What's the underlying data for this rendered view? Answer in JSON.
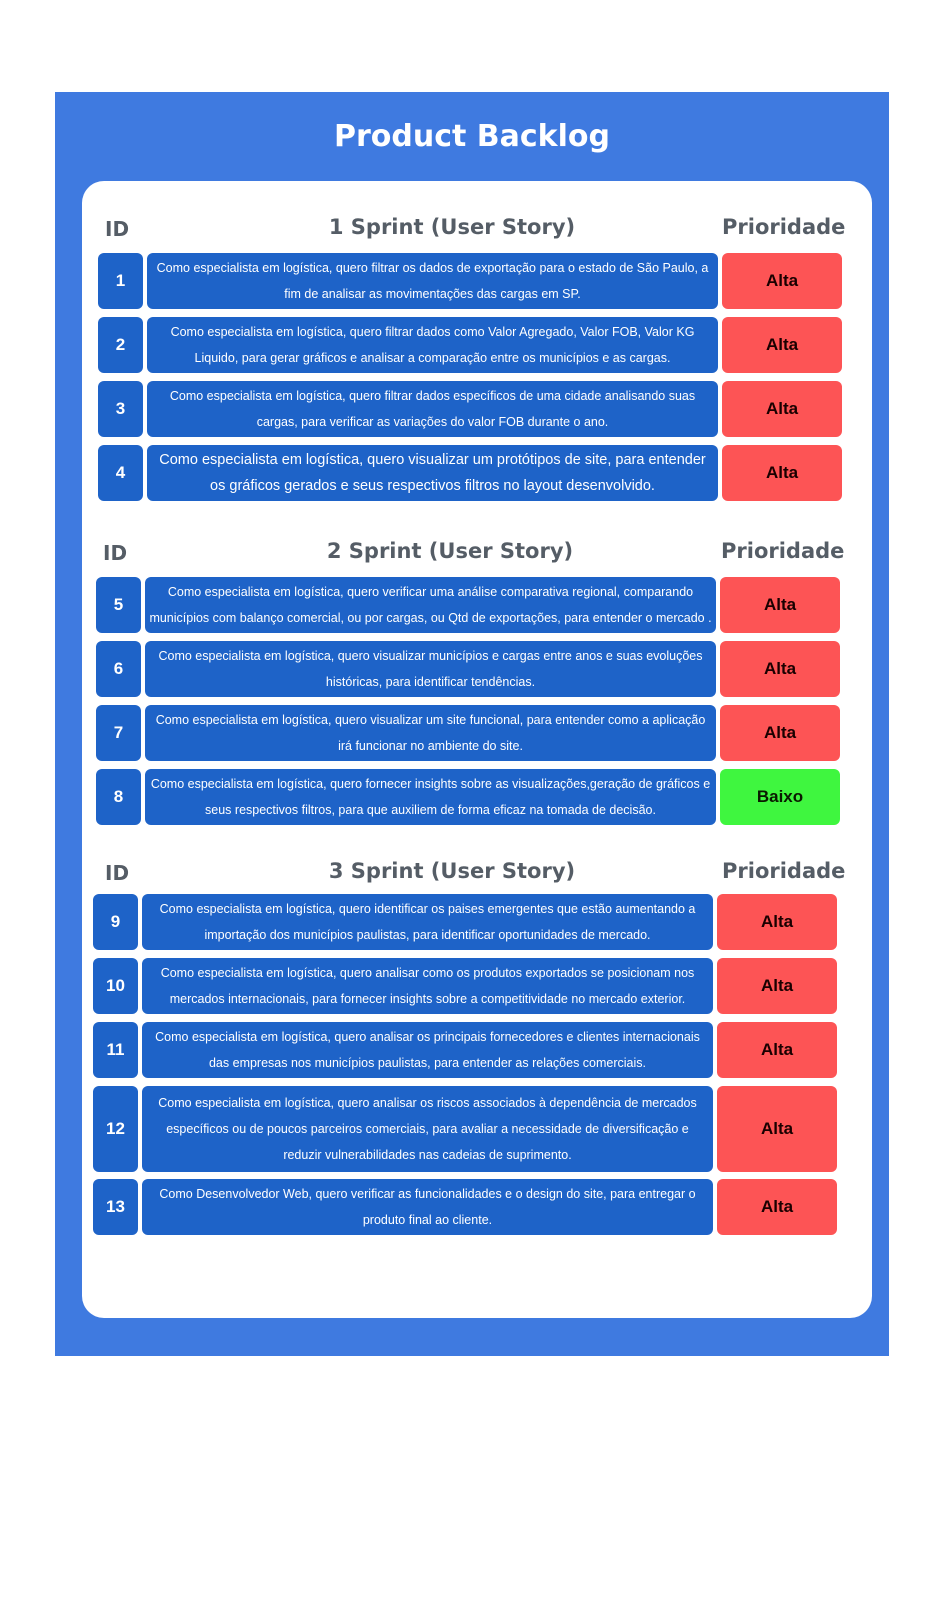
{
  "title": "Product Backlog",
  "colors": {
    "frame": "#3f7ae0",
    "cell_blue": "#1e63c8",
    "priority_high": "#fd5455",
    "priority_low": "#3ff63f",
    "header_text": "#555d66"
  },
  "sprints": [
    {
      "id_header": "ID",
      "title": "1 Sprint  (User Story)",
      "priority_header": "Prioridade",
      "rows": [
        {
          "id": "1",
          "story": "Como especialista em logística, quero filtrar os dados de exportação para o estado de São Paulo, a fim de analisar as movimentações das cargas em SP.",
          "priority": "Alta"
        },
        {
          "id": "2",
          "story": "Como especialista em logística, quero filtrar dados como Valor Agregado, Valor FOB, Valor KG Liquido, para gerar gráficos e analisar a comparação entre os municípios e as cargas.",
          "priority": "Alta"
        },
        {
          "id": "3",
          "story": "Como especialista em logística, quero filtrar dados específicos de uma cidade analisando suas cargas, para verificar as variações do valor FOB durante o ano.",
          "priority": "Alta"
        },
        {
          "id": "4",
          "story": "Como especialista em logística, quero visualizar um protótipos de site, para entender os gráficos gerados e seus respectivos filtros no layout desenvolvido.",
          "priority": "Alta"
        }
      ]
    },
    {
      "id_header": "ID",
      "title": "2 Sprint  (User Story)",
      "priority_header": "Prioridade",
      "rows": [
        {
          "id": "5",
          "story": "Como especialista em logística, quero verificar uma análise comparativa regional, comparando municípios com balanço comercial, ou por cargas, ou Qtd de exportações, para entender o mercado .",
          "priority": "Alta"
        },
        {
          "id": "6",
          "story": "Como especialista em logística, quero visualizar municípios e cargas entre anos e suas evoluções históricas, para identificar tendências.",
          "priority": "Alta"
        },
        {
          "id": "7",
          "story": "Como especialista em logística, quero visualizar um site funcional, para entender como a aplicação irá funcionar no ambiente do site.",
          "priority": "Alta"
        },
        {
          "id": "8",
          "story": "Como especialista em logística, quero fornecer insights sobre as visualizações,geração de gráficos e seus respectivos filtros, para que auxiliem de forma eficaz na tomada de decisão.",
          "priority": "Baixo"
        }
      ]
    },
    {
      "id_header": "ID",
      "title": "3 Sprint  (User Story)",
      "priority_header": "Prioridade",
      "rows": [
        {
          "id": "9",
          "story": "Como especialista em logística, quero identificar os paises emergentes que estão aumentando a importação dos municípios paulistas, para identificar oportunidades de mercado.",
          "priority": "Alta"
        },
        {
          "id": "10",
          "story": "Como especialista em logística, quero analisar como os produtos exportados se posicionam nos mercados internacionais, para fornecer insights sobre a competitividade no mercado exterior.",
          "priority": "Alta"
        },
        {
          "id": "11",
          "story": "Como especialista em logística, quero analisar os principais fornecedores e clientes internacionais das empresas nos municípios paulistas, para entender as relações comerciais.",
          "priority": "Alta"
        },
        {
          "id": "12",
          "story": "Como especialista em logística, quero analisar os riscos associados à dependência de mercados específicos ou de poucos parceiros comerciais, para avaliar a necessidade de diversificação e reduzir vulnerabilidades nas cadeias de suprimento.",
          "priority": "Alta"
        },
        {
          "id": "13",
          "story": "Como Desenvolvedor Web, quero verificar as funcionalidades e o design do site, para entregar o produto final ao cliente.",
          "priority": "Alta"
        }
      ]
    }
  ]
}
